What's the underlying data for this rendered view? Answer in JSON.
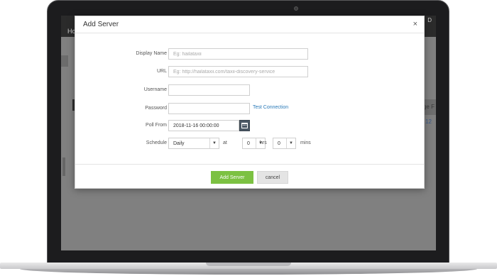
{
  "background_app": {
    "header_text": "Ho",
    "corner_text": "D",
    "column_text": "age F",
    "row_number": "12"
  },
  "dialog": {
    "title": "Add Server",
    "close_glyph": "×"
  },
  "form": {
    "display_name": {
      "label": "Display Name",
      "value": "",
      "placeholder": "Eg: hailataxii"
    },
    "url": {
      "label": "URL",
      "value": "",
      "placeholder": "Eg: http://hailataxii.com/taxii-discovery-service"
    },
    "username": {
      "label": "Username",
      "value": "",
      "placeholder": ""
    },
    "password": {
      "label": "Password",
      "value": "",
      "placeholder": "",
      "test_link": "Test Connection"
    },
    "poll_from": {
      "label": "Poll From",
      "value": "2018-11-16 00:00:00",
      "calendar_icon": "calendar-icon"
    },
    "schedule": {
      "label": "Schedule",
      "frequency": "Daily",
      "at_label": "at",
      "hours": "0",
      "hours_label": "hrs",
      "minutes": "0",
      "minutes_label": "mins"
    }
  },
  "footer": {
    "submit_label": "Add Server",
    "cancel_label": "cancel"
  },
  "colors": {
    "primary_button": "#7cc142",
    "link": "#2a7ab8",
    "calendar_button": "#4a5764",
    "overlay": "#7c7c7c"
  }
}
